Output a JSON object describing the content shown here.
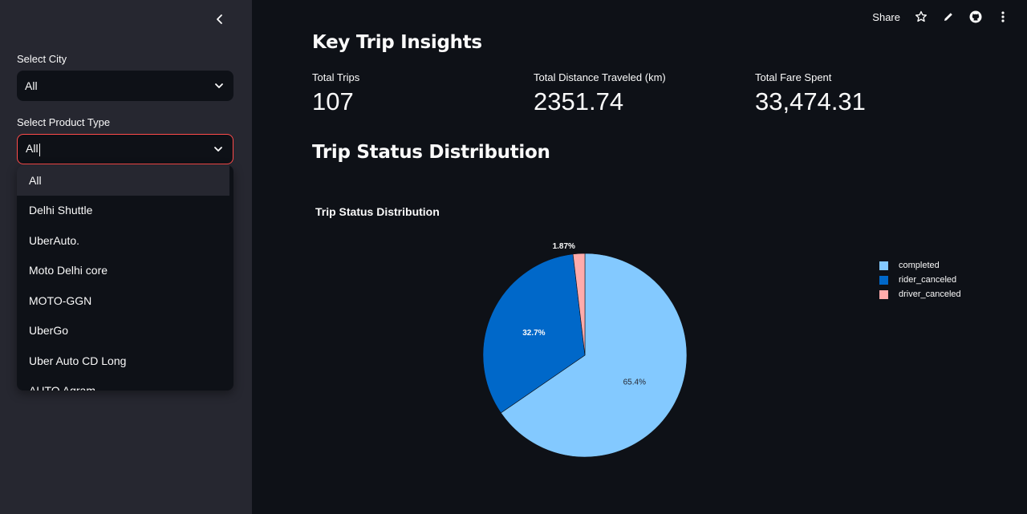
{
  "sidebar": {
    "city": {
      "label": "Select City",
      "value": "All"
    },
    "product": {
      "label": "Select Product Type",
      "value": "All",
      "options": [
        "All",
        "Delhi Shuttle",
        "UberAuto.",
        "Moto Delhi core",
        "MOTO-GGN",
        "UberGo",
        "Uber Auto CD Long",
        "AUTO Agram"
      ]
    }
  },
  "toolbar": {
    "share_label": "Share"
  },
  "main": {
    "insights_title": "Key Trip Insights",
    "metrics": [
      {
        "label": "Total Trips",
        "value": "107"
      },
      {
        "label": "Total Distance Traveled (km)",
        "value": "2351.74"
      },
      {
        "label": "Total Fare Spent",
        "value": "33,474.31"
      }
    ],
    "status_title": "Trip Status Distribution"
  },
  "colors": {
    "completed": "#83c9ff",
    "rider_canceled": "#0068c9",
    "driver_canceled": "#ffabab",
    "focus_border": "#ff4b4b"
  },
  "chart_data": {
    "type": "pie",
    "title": "Trip Status Distribution",
    "labels": [
      "completed",
      "rider_canceled",
      "driver_canceled"
    ],
    "values": [
      65.4,
      32.7,
      1.87
    ],
    "value_labels": [
      "65.4%",
      "32.7%",
      "1.87%"
    ],
    "legend_position": "right"
  }
}
